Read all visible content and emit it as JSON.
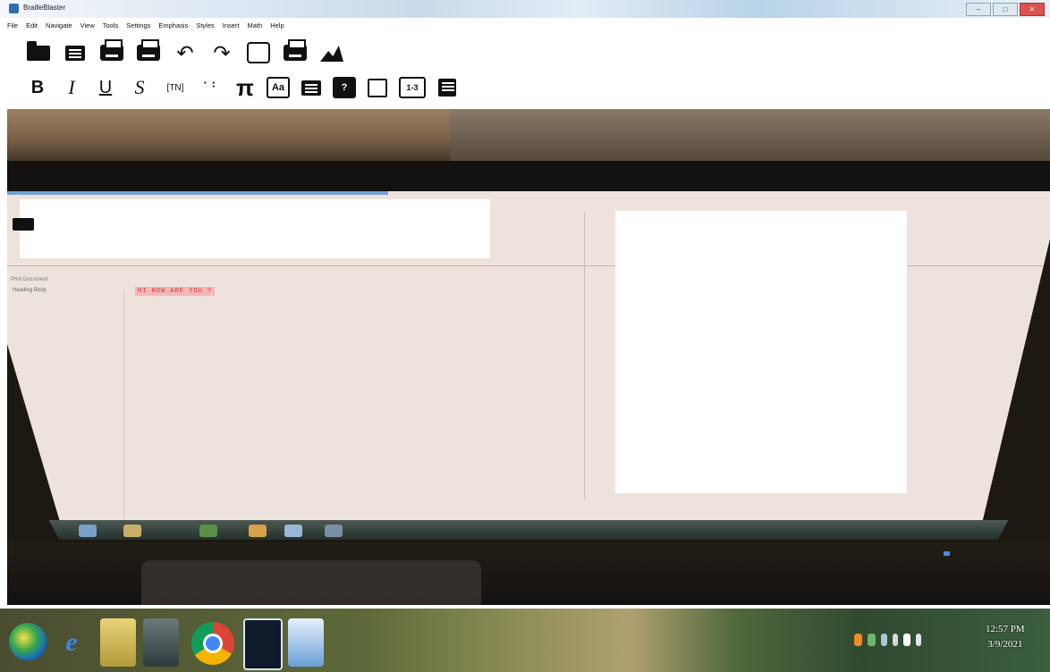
{
  "window": {
    "title": "BrailleBlaster",
    "controls": {
      "minimize": "–",
      "maximize": "□",
      "close": "✕"
    }
  },
  "menubar": {
    "items": [
      "File",
      "Edit",
      "Navigate",
      "View",
      "Tools",
      "Settings",
      "Emphasis",
      "Styles",
      "Insert",
      "Math",
      "Help"
    ]
  },
  "toolbar_row1": {
    "icons": [
      "open-folder-icon",
      "save-icon",
      "print-icon",
      "embosser-icon",
      "undo-icon",
      "redo-icon",
      "translate-icon",
      "emboss-icon",
      "image-describer-icon"
    ],
    "undo_glyph": "↶",
    "redo_glyph": "↷"
  },
  "toolbar_row2": {
    "bold": "B",
    "italic": "I",
    "underline": "U",
    "script": "S",
    "tn": "[TN]",
    "braille": "⠁⠃",
    "pi": "π",
    "aa": "Aa",
    "q": "?",
    "range": "1-3"
  },
  "document": {
    "highlighted_text": "HI HOW ARE YOU ?",
    "status_left": "Print Document",
    "para_label": "Heading  Body"
  },
  "taskbar": {
    "ie_glyph": "e",
    "clock_time": "12:57 PM",
    "clock_date": "3/9/2021"
  },
  "colors": {
    "highlight_bg": "#f6b6b6",
    "highlight_fg": "#c43535",
    "taskbar_accent": "#5e6a3a"
  }
}
